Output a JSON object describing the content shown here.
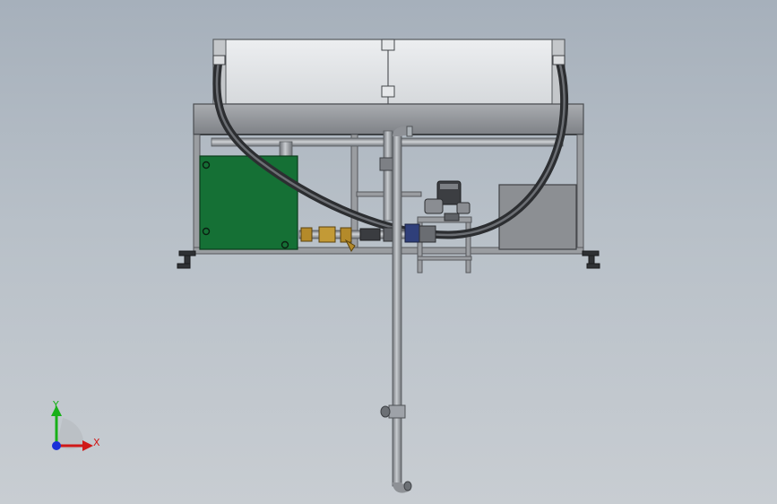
{
  "triad": {
    "y_label": "Y",
    "x_label": "X",
    "y_color": "#18b018",
    "x_color": "#d01818",
    "z_color": "#1a2fd8"
  },
  "colors": {
    "frame": "#8a8d92",
    "panel": "#e2e4e6",
    "pipe": "#9ea2a8",
    "hose": "#3a3c40",
    "tank_green": "#157035",
    "box_gray": "#8c8f93",
    "brass": "#b48a2a"
  },
  "components": [
    "panel-housing",
    "frame",
    "fluid-tank",
    "electrical-box",
    "pump-motor",
    "flexible-hose",
    "drain-pipe",
    "strainer-valve",
    "leveling-feet"
  ]
}
